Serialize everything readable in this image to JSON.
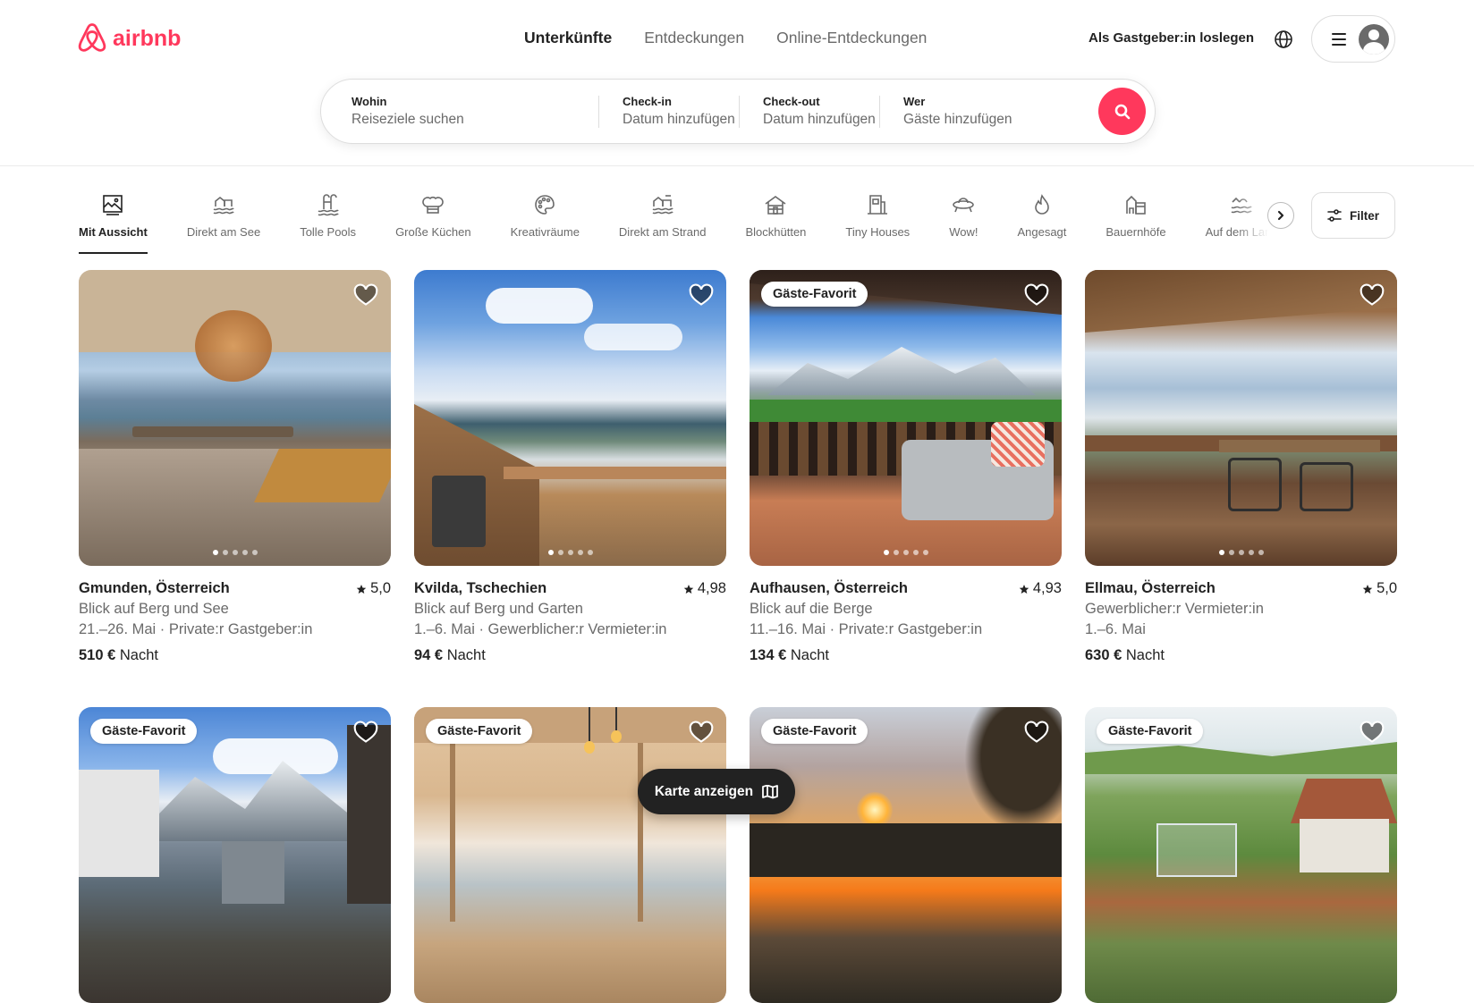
{
  "brand": {
    "name": "airbnb",
    "color": "#FF385C",
    "icon": "airbnb-logo-icon"
  },
  "nav": {
    "items": [
      {
        "label": "Unterkünfte",
        "active": true
      },
      {
        "label": "Entdeckungen",
        "active": false
      },
      {
        "label": "Online-Entdeckungen",
        "active": false
      }
    ]
  },
  "header": {
    "host_link": "Als Gastgeber:in loslegen",
    "globe_icon": "globe-icon",
    "menu_icon": "hamburger-menu-icon",
    "avatar_icon": "user-avatar-icon"
  },
  "search": {
    "where": {
      "label": "Wohin",
      "placeholder": "Reiseziele suchen"
    },
    "checkin": {
      "label": "Check-in",
      "placeholder": "Datum hinzufügen"
    },
    "checkout": {
      "label": "Check-out",
      "placeholder": "Datum hinzufügen"
    },
    "who": {
      "label": "Wer",
      "placeholder": "Gäste hinzufügen"
    },
    "button_icon": "search-icon"
  },
  "categories": [
    {
      "label": "Mit Aussicht",
      "icon": "view-icon",
      "active": true
    },
    {
      "label": "Direkt am See",
      "icon": "lake-icon",
      "active": false
    },
    {
      "label": "Tolle Pools",
      "icon": "pool-icon",
      "active": false
    },
    {
      "label": "Große Küchen",
      "icon": "chef-hat-icon",
      "active": false
    },
    {
      "label": "Kreativräume",
      "icon": "palette-icon",
      "active": false
    },
    {
      "label": "Direkt am Strand",
      "icon": "beach-icon",
      "active": false
    },
    {
      "label": "Blockhütten",
      "icon": "cabin-icon",
      "active": false
    },
    {
      "label": "Tiny Houses",
      "icon": "tiny-house-icon",
      "active": false
    },
    {
      "label": "Wow!",
      "icon": "ufo-icon",
      "active": false
    },
    {
      "label": "Angesagt",
      "icon": "flame-icon",
      "active": false
    },
    {
      "label": "Bauernhöfe",
      "icon": "farm-icon",
      "active": false
    },
    {
      "label": "Auf dem Land",
      "icon": "countryside-icon",
      "active": false
    }
  ],
  "filter": {
    "label": "Filter",
    "icon": "sliders-icon"
  },
  "listings": [
    {
      "title": "Gmunden, Österreich",
      "rating": "5,0",
      "desc": "Blick auf Berg und See",
      "dates": "21.–26. Mai · Private:r Gastgeber:in",
      "price": "510 €",
      "unit": "Nacht",
      "badge": ""
    },
    {
      "title": "Kvilda, Tschechien",
      "rating": "4,98",
      "desc": "Blick auf Berg und Garten",
      "dates": "1.–6. Mai · Gewerblicher:r Vermieter:in",
      "price": "94 €",
      "unit": "Nacht",
      "badge": ""
    },
    {
      "title": "Aufhausen, Österreich",
      "rating": "4,93",
      "desc": "Blick auf die Berge",
      "dates": "11.–16. Mai · Private:r Gastgeber:in",
      "price": "134 €",
      "unit": "Nacht",
      "badge": "Gäste-Favorit"
    },
    {
      "title": "Ellmau, Österreich",
      "rating": "5,0",
      "desc": "Gewerblicher:r Vermieter:in",
      "dates": "1.–6. Mai",
      "price": "630 €",
      "unit": "Nacht",
      "badge": ""
    },
    {
      "badge": "Gäste-Favorit"
    },
    {
      "badge": "Gäste-Favorit"
    },
    {
      "badge": "Gäste-Favorit"
    },
    {
      "badge": "Gäste-Favorit"
    }
  ],
  "map_button": {
    "label": "Karte anzeigen",
    "icon": "map-icon"
  }
}
